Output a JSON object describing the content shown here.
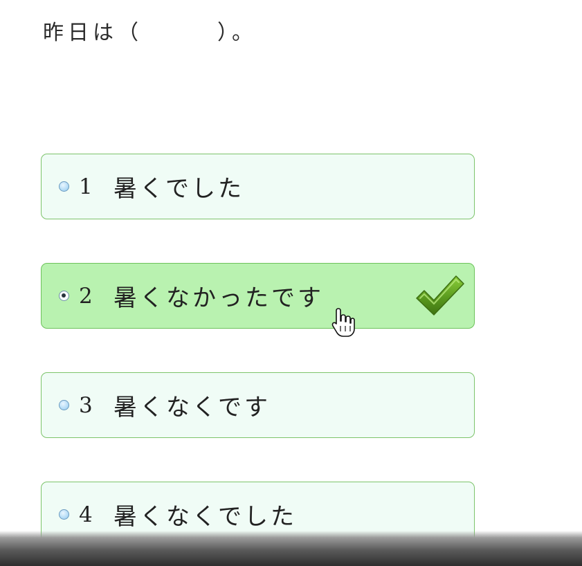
{
  "question": {
    "text": "昨日は（　　　）。"
  },
  "options": [
    {
      "number": "1",
      "label": "暑くでした",
      "selected": false
    },
    {
      "number": "2",
      "label": "暑くなかったです",
      "selected": true
    },
    {
      "number": "3",
      "label": "暑くなくです",
      "selected": false
    },
    {
      "number": "4",
      "label": "暑くなくでした",
      "selected": false
    }
  ],
  "icons": {
    "check": "checkmark-icon",
    "cursor": "hand-pointer-cursor-icon"
  },
  "colors": {
    "option_background": "#f0fcf6",
    "option_border": "#7cc36a",
    "selected_background": "#b9f2b0",
    "check_green": "#5a9a1e"
  }
}
